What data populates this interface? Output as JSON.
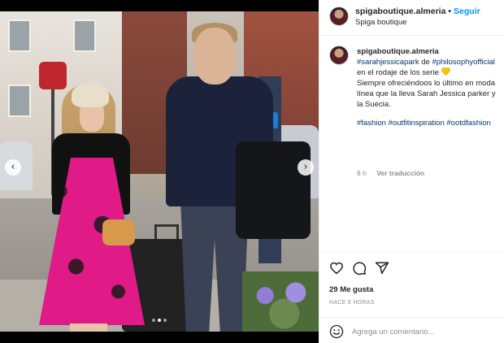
{
  "post": {
    "header": {
      "username": "spigaboutique.almeria",
      "separator": "•",
      "follow_label": "Seguir",
      "location": "Spiga boutique",
      "avatar_icon": "profile-avatar"
    },
    "caption": {
      "username": "spigaboutique.almeria",
      "tag_1": "#sarahjessicapark",
      "text_1": " de ",
      "tag_2": "#philosophyofficial",
      "text_2": " en el rodaje de los serie ",
      "emoji": "yellow-heart",
      "text_3": "Siempre ofreciéndoos lo último en moda línea que la lleva Sarah Jessica parker y la Suecia.",
      "hashtags": [
        "#fashion",
        "#outfitinspiration",
        "#ootdfashion"
      ],
      "time": "8 h",
      "translate_label": "Ver traducción"
    },
    "actions": {
      "like_icon": "heart-outline",
      "comment_icon": "speech-bubble",
      "share_icon": "paper-plane",
      "likes_text": "29 Me gusta",
      "timestamp": "HACE 8 HORAS"
    },
    "comment": {
      "placeholder": "Agrega un comentario...",
      "emoji_icon": "smiley"
    },
    "carousel": {
      "prev_icon": "chevron-left",
      "next_icon": "chevron-right",
      "dots": 3,
      "active_dot": 2
    }
  },
  "colors": {
    "accent": "#0095f6",
    "link": "#00376b",
    "text": "#262626",
    "muted": "#8e8e8e",
    "dress": "#e01a86"
  }
}
